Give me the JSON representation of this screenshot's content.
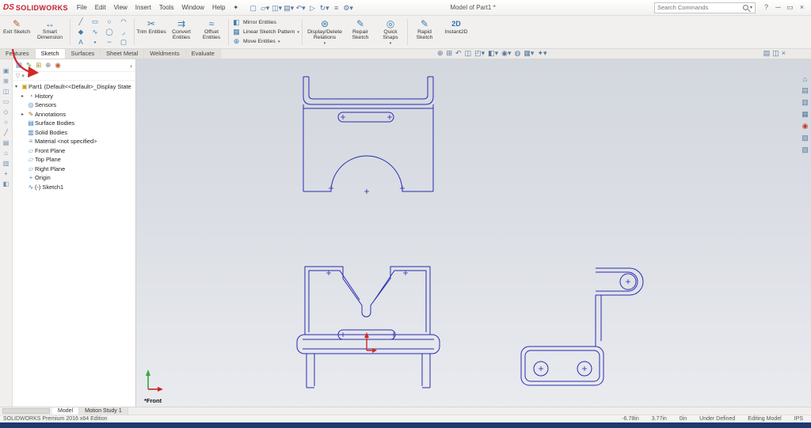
{
  "colors": {
    "sketch-line": "#2b2bb0",
    "annotation-red": "#cf2a27",
    "origin-red": "#d42a20",
    "triad-green": "#3da53d",
    "triad-red": "#cc2222",
    "accent-blue": "#2f6fa8"
  },
  "titlebar": {
    "logo_ds": "DS",
    "logo_text": "SOLIDWORKS",
    "menus": [
      {
        "name": "menu-file",
        "label": "File"
      },
      {
        "name": "menu-edit",
        "label": "Edit"
      },
      {
        "name": "menu-view",
        "label": "View"
      },
      {
        "name": "menu-insert",
        "label": "Insert"
      },
      {
        "name": "menu-tools",
        "label": "Tools"
      },
      {
        "name": "menu-window",
        "label": "Window"
      },
      {
        "name": "menu-help",
        "label": "Help"
      },
      {
        "name": "pin-icon",
        "label": "✦"
      }
    ],
    "qat_icons": [
      {
        "name": "new-document-icon",
        "glyph": "▢"
      },
      {
        "name": "open-document-icon",
        "glyph": "▱▾"
      },
      {
        "name": "save-icon",
        "glyph": "◫▾"
      },
      {
        "name": "print-icon",
        "glyph": "▤▾"
      },
      {
        "name": "undo-icon",
        "glyph": "↶▾"
      },
      {
        "name": "select-icon",
        "glyph": "▷"
      },
      {
        "name": "rebuild-icon",
        "glyph": "↻▾"
      },
      {
        "name": "file-properties-icon",
        "glyph": "≡"
      },
      {
        "name": "options-icon",
        "glyph": "⚙▾"
      }
    ],
    "document_title": "Model of Part1 *",
    "search_placeholder": "Search Commands",
    "search_caret": "▾",
    "window_icons": [
      {
        "name": "help-icon",
        "glyph": "?"
      },
      {
        "name": "minimize-icon",
        "glyph": "─"
      },
      {
        "name": "restore-icon",
        "glyph": "▭"
      },
      {
        "name": "close-icon",
        "glyph": "×"
      }
    ]
  },
  "ribbon": {
    "exit_sketch": "Exit Sketch",
    "smart_dimension": "Smart Dimension",
    "trim": "Trim Entities",
    "convert": "Convert Entities",
    "offset": "Offset Entities",
    "mirror": "Mirror Entities",
    "linear_pattern": "Linear Sketch Pattern",
    "move": "Move Entities",
    "display_delete": "Display/Delete Relations",
    "repair": "Repair Sketch",
    "quick_snaps": "Quick Snaps",
    "rapid_sketch": "Rapid Sketch",
    "instant2d": "Instant2D",
    "icons": {
      "exit_sketch": "✎",
      "smart_dimension": "↔",
      "trim": "✂",
      "convert": "⇉",
      "offset": "≈",
      "mirror": "◧",
      "linear_pattern": "▦",
      "move": "⊕",
      "display_delete": "⊛",
      "repair": "✎",
      "quick_snaps": "◎",
      "rapid_sketch": "✎",
      "instant2d": "2D",
      "caret": "▾"
    },
    "sketch_grid": [
      {
        "name": "line-icon",
        "glyph": "╱"
      },
      {
        "name": "rectangle-icon",
        "glyph": "▭"
      },
      {
        "name": "circle-icon",
        "glyph": "○"
      },
      {
        "name": "arc-icon",
        "glyph": "◠"
      },
      {
        "name": "polygon-icon",
        "glyph": "◆"
      },
      {
        "name": "spline-icon",
        "glyph": "∿"
      },
      {
        "name": "ellipse-icon",
        "glyph": "◯"
      },
      {
        "name": "fillet-icon",
        "glyph": "◞"
      },
      {
        "name": "text-icon",
        "glyph": "A"
      },
      {
        "name": "point-icon",
        "glyph": "•"
      },
      {
        "name": "centerline-icon",
        "glyph": "╌"
      },
      {
        "name": "slot-icon",
        "glyph": "▢"
      }
    ]
  },
  "tabstrip": {
    "tabs": [
      {
        "name": "tab-features",
        "label": "Features"
      },
      {
        "name": "tab-sketch",
        "label": "Sketch",
        "active": true
      },
      {
        "name": "tab-surfaces",
        "label": "Surfaces"
      },
      {
        "name": "tab-sheet-metal",
        "label": "Sheet Metal"
      },
      {
        "name": "tab-weldments",
        "label": "Weldments"
      },
      {
        "name": "tab-evaluate",
        "label": "Evaluate"
      }
    ],
    "headsup": [
      {
        "name": "zoom-fit-icon",
        "glyph": "⊕"
      },
      {
        "name": "zoom-area-icon",
        "glyph": "⊞"
      },
      {
        "name": "previous-view-icon",
        "glyph": "↶"
      },
      {
        "name": "section-view-icon",
        "glyph": "◫"
      },
      {
        "name": "view-orientation-icon",
        "glyph": "◰▾"
      },
      {
        "name": "display-style-icon",
        "glyph": "◧▾"
      },
      {
        "name": "hide-show-items-icon",
        "glyph": "◉▾"
      },
      {
        "name": "edit-appearance-icon",
        "glyph": "◍"
      },
      {
        "name": "apply-scene-icon",
        "glyph": "▦▾"
      },
      {
        "name": "view-settings-icon",
        "glyph": "✦▾"
      }
    ],
    "pane_icons": [
      {
        "name": "expand-pane-icon",
        "glyph": "▤"
      },
      {
        "name": "split-pane-icon",
        "glyph": "◫"
      },
      {
        "name": "close-pane-icon",
        "glyph": "×"
      }
    ]
  },
  "left_strip": [
    {
      "name": "left-toolbar-icon",
      "glyph": "▣"
    },
    {
      "name": "left-toolbar-icon",
      "glyph": "⊞"
    },
    {
      "name": "left-toolbar-icon",
      "glyph": "◫"
    },
    {
      "name": "left-toolbar-icon",
      "glyph": "▭"
    },
    {
      "name": "left-toolbar-icon",
      "glyph": "◇"
    },
    {
      "name": "left-toolbar-icon",
      "glyph": "○"
    },
    {
      "name": "left-toolbar-icon",
      "glyph": "╱"
    },
    {
      "name": "left-toolbar-icon",
      "glyph": "▤"
    },
    {
      "name": "left-toolbar-icon",
      "glyph": "⌂"
    },
    {
      "name": "left-toolbar-icon",
      "glyph": "▥"
    },
    {
      "name": "left-toolbar-icon",
      "glyph": "+"
    },
    {
      "name": "left-toolbar-icon",
      "glyph": "◧"
    }
  ],
  "panel": {
    "header_icons": [
      {
        "name": "featuremanager-tree-icon",
        "glyph": "▤",
        "color": "#3a78c2"
      },
      {
        "name": "propertymanager-icon",
        "glyph": "✎",
        "color": "#3f9d3f"
      },
      {
        "name": "configurationmanager-icon",
        "glyph": "⊞",
        "color": "#b08a2e"
      },
      {
        "name": "dimxpert-icon",
        "glyph": "⊕",
        "color": "#777777"
      },
      {
        "name": "displaymanager-icon",
        "glyph": "◉",
        "color": "#c06030"
      },
      {
        "name": "panel-expand-icon",
        "glyph": "›"
      }
    ],
    "filter_icon": "▽",
    "filter_caret": "▾"
  },
  "tree": {
    "caret_glyph": "▸",
    "root_caret": "▾",
    "root_icon": "▣",
    "root": "Part1  (Default<<Default>_Display State",
    "items": [
      {
        "label": "History",
        "glyph": "◔",
        "color": "#7a7a7a",
        "caret": true,
        "icon_name": "history-icon"
      },
      {
        "label": "Sensors",
        "glyph": "◎",
        "color": "#3a78c2",
        "caret": false,
        "icon_name": "sensors-icon"
      },
      {
        "label": "Annotations",
        "glyph": "✎",
        "color": "#9a7b2d",
        "caret": true,
        "icon_name": "annotations-icon"
      },
      {
        "label": "Surface Bodies",
        "glyph": "▤",
        "color": "#3a78c2",
        "caret": false,
        "icon_name": "surface-bodies-icon"
      },
      {
        "label": "Solid Bodies",
        "glyph": "▥",
        "color": "#3a78c2",
        "caret": false,
        "icon_name": "solid-bodies-icon"
      },
      {
        "label": "Material <not specified>",
        "glyph": "≡",
        "color": "#888888",
        "caret": false,
        "icon_name": "material-icon"
      },
      {
        "label": "Front Plane",
        "glyph": "▱",
        "color": "#4a90c4",
        "caret": false,
        "icon_name": "plane-icon"
      },
      {
        "label": "Top Plane",
        "glyph": "▱",
        "color": "#4a90c4",
        "caret": false,
        "icon_name": "plane-icon"
      },
      {
        "label": "Right Plane",
        "glyph": "▱",
        "color": "#4a90c4",
        "caret": false,
        "icon_name": "plane-icon"
      },
      {
        "label": "Origin",
        "glyph": "+",
        "color": "#4a90c4",
        "caret": false,
        "icon_name": "origin-icon"
      },
      {
        "label": "(-) Sketch1",
        "glyph": "∿",
        "color": "#3a78c2",
        "caret": false,
        "icon_name": "sketch-icon"
      }
    ]
  },
  "viewport": {
    "view_label": "*Front",
    "task_icons": [
      {
        "name": "resources-icon",
        "glyph": "⌂"
      },
      {
        "name": "design-library-icon",
        "glyph": "▤"
      },
      {
        "name": "file-explorer-icon",
        "glyph": "▥"
      },
      {
        "name": "view-palette-icon",
        "glyph": "▦"
      },
      {
        "name": "appearances-icon",
        "glyph": "◉",
        "color": "#c0392b"
      },
      {
        "name": "custom-properties-icon",
        "glyph": "▧"
      },
      {
        "name": "forum-icon",
        "glyph": "▨"
      }
    ]
  },
  "bottom_tabs": {
    "tabs": [
      {
        "name": "model-tab",
        "label": "Model",
        "active": true
      },
      {
        "name": "motion-study-tab",
        "label": "Motion Study 1"
      }
    ]
  },
  "statusbar": {
    "edition": "SOLIDWORKS Premium 2016 x64 Edition",
    "x": "-6.78in",
    "y": "3.77in",
    "z": "0in",
    "constraint_status": "Under Defined",
    "mode": "Editing Model",
    "units": "IPS"
  }
}
